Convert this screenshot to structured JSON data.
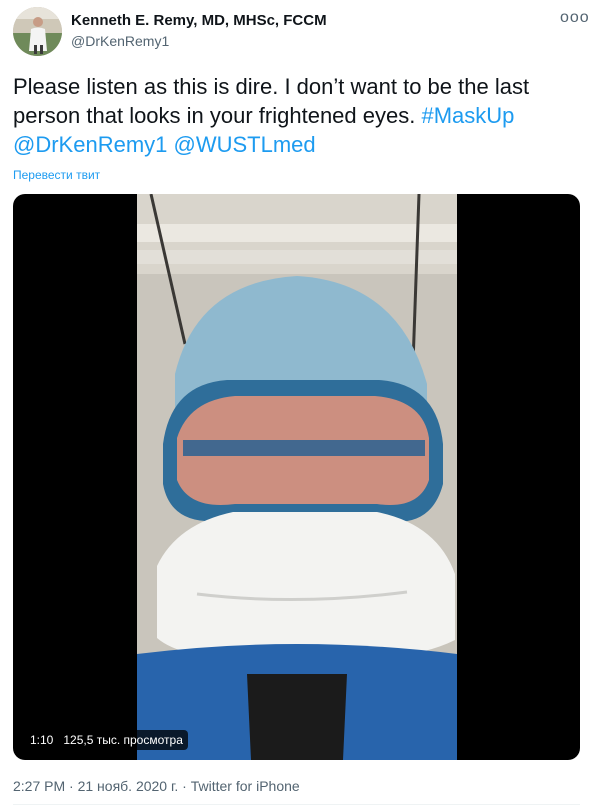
{
  "author": {
    "name": "Kenneth E. Remy, MD, MHSc, FCCM",
    "handle": "@DrKenRemy1",
    "avatar_icon": "person-photo-icon",
    "more_icon": "more-dots-icon",
    "more_glyph": "ooo"
  },
  "tweet": {
    "text_plain": "Please listen as this is dire.  I don’t want to be the last person that looks in your frightened eyes. ",
    "hashtag": "#MaskUp",
    "mention_1": "@DrKenRemy1",
    "mention_2": "@WUSTLmed",
    "translate": "Перевести твит"
  },
  "media": {
    "type": "video",
    "duration": "1:10",
    "views": "125,5 тыс. просмотра"
  },
  "footer": {
    "time": "2:27 PM",
    "separator": " · ",
    "date": "21 нояб. 2020 г.",
    "client": "Twitter for iPhone"
  },
  "colors": {
    "link": "#1d9bf0",
    "secondary_text": "#536471",
    "media_background": "#000000"
  }
}
